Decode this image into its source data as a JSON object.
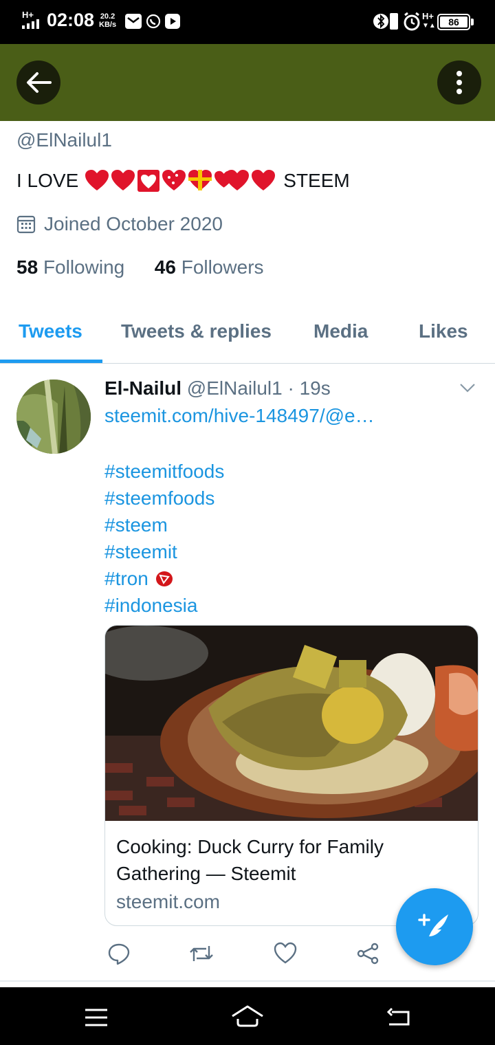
{
  "status_bar": {
    "network": "H+",
    "time": "02:08",
    "speed_value": "20.2",
    "speed_unit": "KB/s",
    "right_network": "H+",
    "battery": "86"
  },
  "profile": {
    "handle": "@ElNailul1",
    "bio_start": "I LOVE",
    "bio_end": "STEEM",
    "joined": "Joined October 2020",
    "following_count": "58",
    "following_label": "Following",
    "followers_count": "46",
    "followers_label": "Followers"
  },
  "tabs": [
    {
      "label": "Tweets",
      "active": true
    },
    {
      "label": "Tweets & replies",
      "active": false
    },
    {
      "label": "Media",
      "active": false
    },
    {
      "label": "Likes",
      "active": false
    }
  ],
  "tweet": {
    "name": "El-Nailul",
    "handle": "@ElNailul1",
    "time": "· 19s",
    "link": "steemit.com/hive-148497/@e…",
    "hashtags": [
      "#steemitfoods",
      "#steemfoods",
      "#steem",
      "#steemit",
      "#tron",
      "#indonesia"
    ],
    "card": {
      "title": "Cooking: Duck Curry for Family Gathering — Steemit",
      "domain": "steemit.com"
    }
  },
  "colors": {
    "header": "#4a5e17",
    "accent": "#1d9bf0",
    "muted": "#5b7083"
  },
  "icons": [
    "back-arrow-icon",
    "more-vertical-icon",
    "calendar-icon",
    "chevron-down-icon",
    "reply-icon",
    "retweet-icon",
    "like-icon",
    "share-icon",
    "compose-icon"
  ]
}
